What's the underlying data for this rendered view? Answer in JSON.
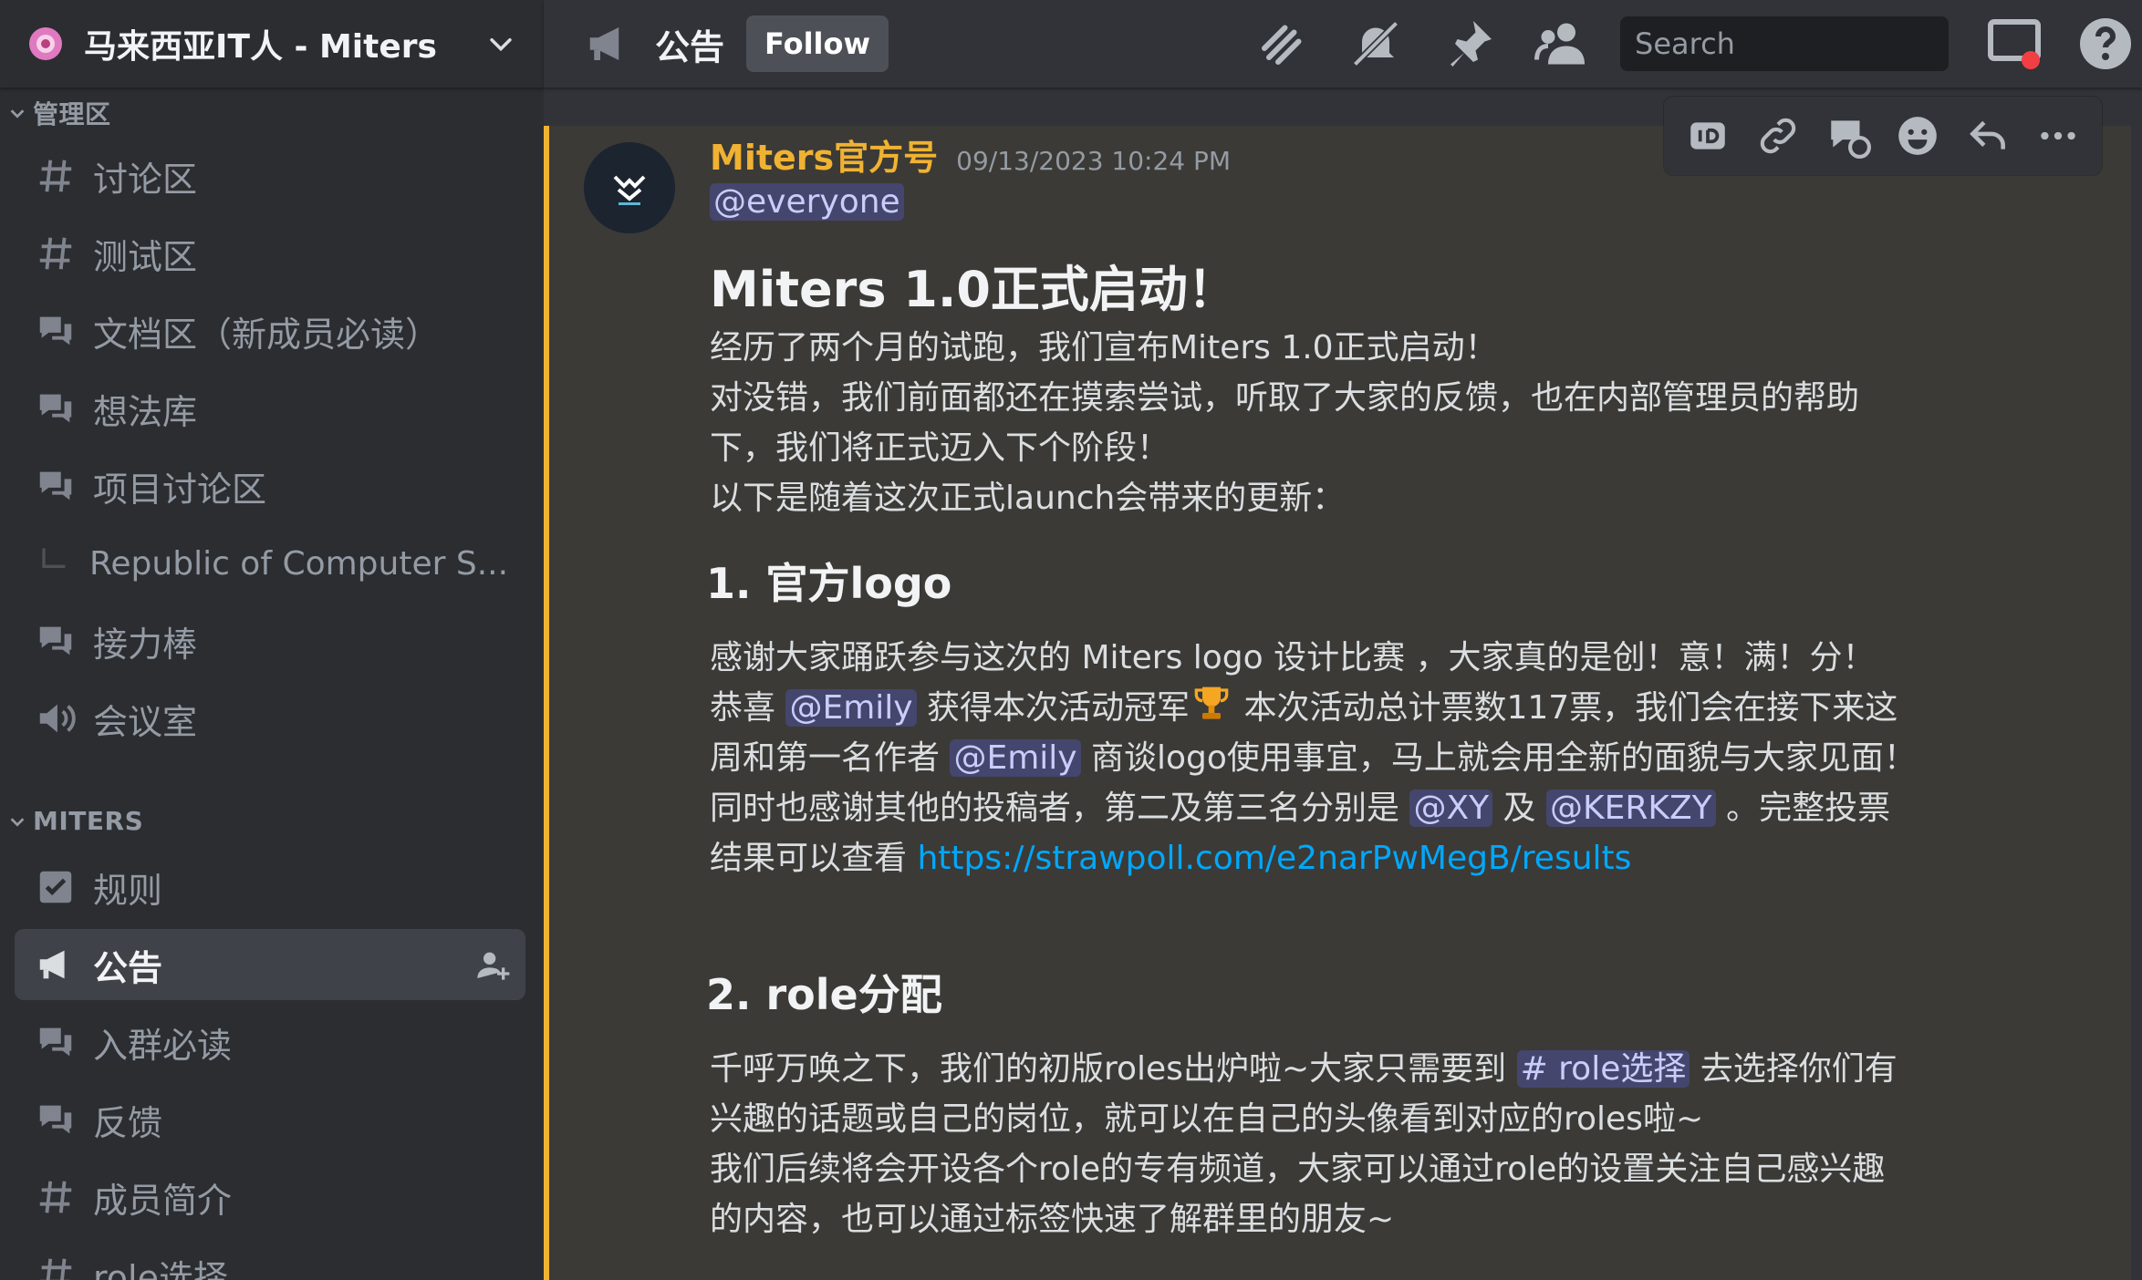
{
  "server": {
    "name": "马来西亚IT人 - Miters"
  },
  "sidebar": {
    "category_admin": "管理区",
    "category_miters": "MITERS",
    "admin_channels": [
      {
        "label": "讨论区",
        "icon": "text-channel-icon"
      },
      {
        "label": "测试区",
        "icon": "text-channel-icon"
      },
      {
        "label": "文档区（新成员必读）",
        "icon": "forum-channel-icon"
      },
      {
        "label": "想法库",
        "icon": "forum-channel-icon"
      },
      {
        "label": "项目讨论区",
        "icon": "forum-channel-icon"
      }
    ],
    "thread": {
      "label": "Republic of Computer S..."
    },
    "admin_channels_2": [
      {
        "label": "接力棒",
        "icon": "forum-channel-icon"
      },
      {
        "label": "会议室",
        "icon": "stage-channel-icon"
      }
    ],
    "miters_channels": [
      {
        "label": "规则",
        "icon": "rules-icon"
      },
      {
        "label": "公告",
        "icon": "announcement-icon",
        "active": true
      },
      {
        "label": "入群必读",
        "icon": "forum-channel-icon"
      },
      {
        "label": "反馈",
        "icon": "forum-channel-icon"
      },
      {
        "label": "成员简介",
        "icon": "text-channel-icon"
      },
      {
        "label": "role选择",
        "icon": "text-channel-icon"
      }
    ]
  },
  "topbar": {
    "channel_name": "公告",
    "follow_label": "Follow",
    "search_placeholder": "Search"
  },
  "message": {
    "author": "Miters官方号",
    "timestamp": "09/13/2023 10:24 PM",
    "everyone": "@everyone",
    "title": "Miters 1.0正式启动！",
    "intro": [
      "经历了两个月的试跑，我们宣布Miters 1.0正式启动！",
      "对没错，我们前面都还在摸索尝试，听取了大家的反馈，也在内部管理员的帮助",
      "下，我们将正式迈入下个阶段！",
      "以下是随着这次正式launch会带来的更新："
    ],
    "section1": {
      "heading": "1. 官方logo",
      "line1": "感谢大家踊跃参与这次的 Miters logo 设计比赛 ，大家真的是创！意！满！分！",
      "l2a": "恭喜 ",
      "mention_emily": "@Emily",
      "l2b": " 获得本次活动冠军",
      "l2c": " 本次活动总计票数117票，我们会在接下来这",
      "l3a": "周和第一名作者 ",
      "l3b": " 商谈logo使用事宜，马上就会用全新的面貌与大家见面！",
      "l4a": "同时也感谢其他的投稿者，第二及第三名分别是 ",
      "mention_xy": "@XY",
      "l4b": " 及 ",
      "mention_kerkzy": "@KERKZY",
      "l4c": " 。完整投票",
      "l5a": "结果可以查看 ",
      "link": "https://strawpoll.com/e2narPwMegB/results"
    },
    "section2": {
      "heading": "2. role分配",
      "l1a": "千呼万唤之下，我们的初版roles出炉啦~大家只需要到 ",
      "channel_mention": "# role选择",
      "l1b": " 去选择你们有",
      "l2": "兴趣的话题或自己的岗位，就可以在自己的头像看到对应的roles啦~",
      "l3": "我们后续将会开设各个role的专有频道，大家可以通过role的设置关注自己感兴趣",
      "l4": "的内容，也可以通过标签快速了解群里的朋友~"
    }
  },
  "colors": {
    "accent_gold": "#f0b232",
    "mention_bg": "#414674",
    "link": "#00a8fc",
    "sidebar_bg": "#2b2d31",
    "main_bg": "#313338"
  }
}
